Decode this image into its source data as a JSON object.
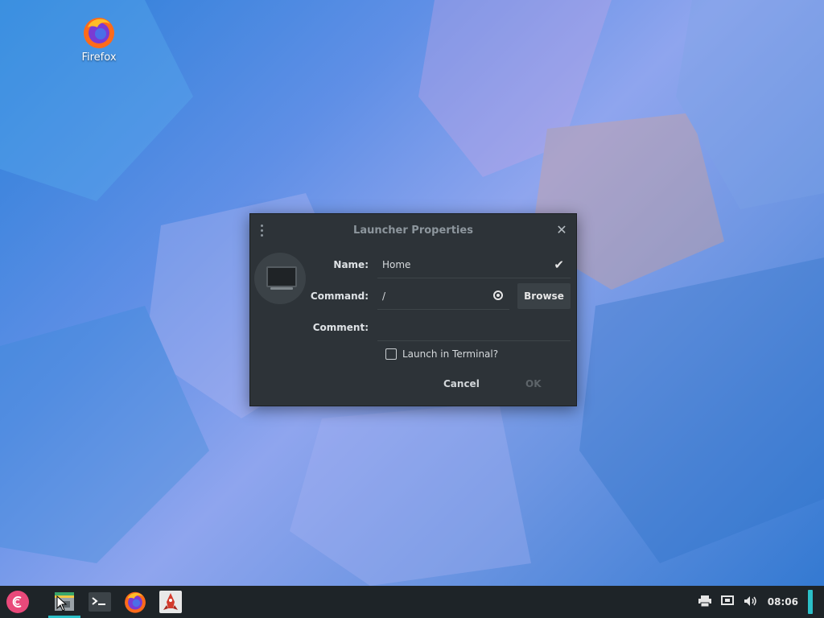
{
  "desktop": {
    "icons": [
      {
        "label": "Firefox",
        "icon": "firefox-icon"
      }
    ]
  },
  "dialog": {
    "title": "Launcher Properties",
    "name_label": "Name:",
    "name_value": "Home",
    "command_label": "Command:",
    "command_value": "/",
    "comment_label": "Comment:",
    "comment_value": "",
    "browse_label": "Browse",
    "terminal_label": "Launch in Terminal?",
    "terminal_checked": false,
    "cancel_label": "Cancel",
    "ok_label": "OK"
  },
  "taskbar": {
    "apps": [
      {
        "name": "start-menu",
        "icon": "debian-swirl-icon"
      },
      {
        "name": "files",
        "icon": "file-manager-icon",
        "active": true
      },
      {
        "name": "terminal",
        "icon": "terminal-icon"
      },
      {
        "name": "firefox",
        "icon": "firefox-icon"
      },
      {
        "name": "app",
        "icon": "rocket-icon"
      }
    ],
    "clock": "08:06",
    "colors": {
      "accent": "#2bc0c8",
      "bar": "#1e2428"
    }
  }
}
